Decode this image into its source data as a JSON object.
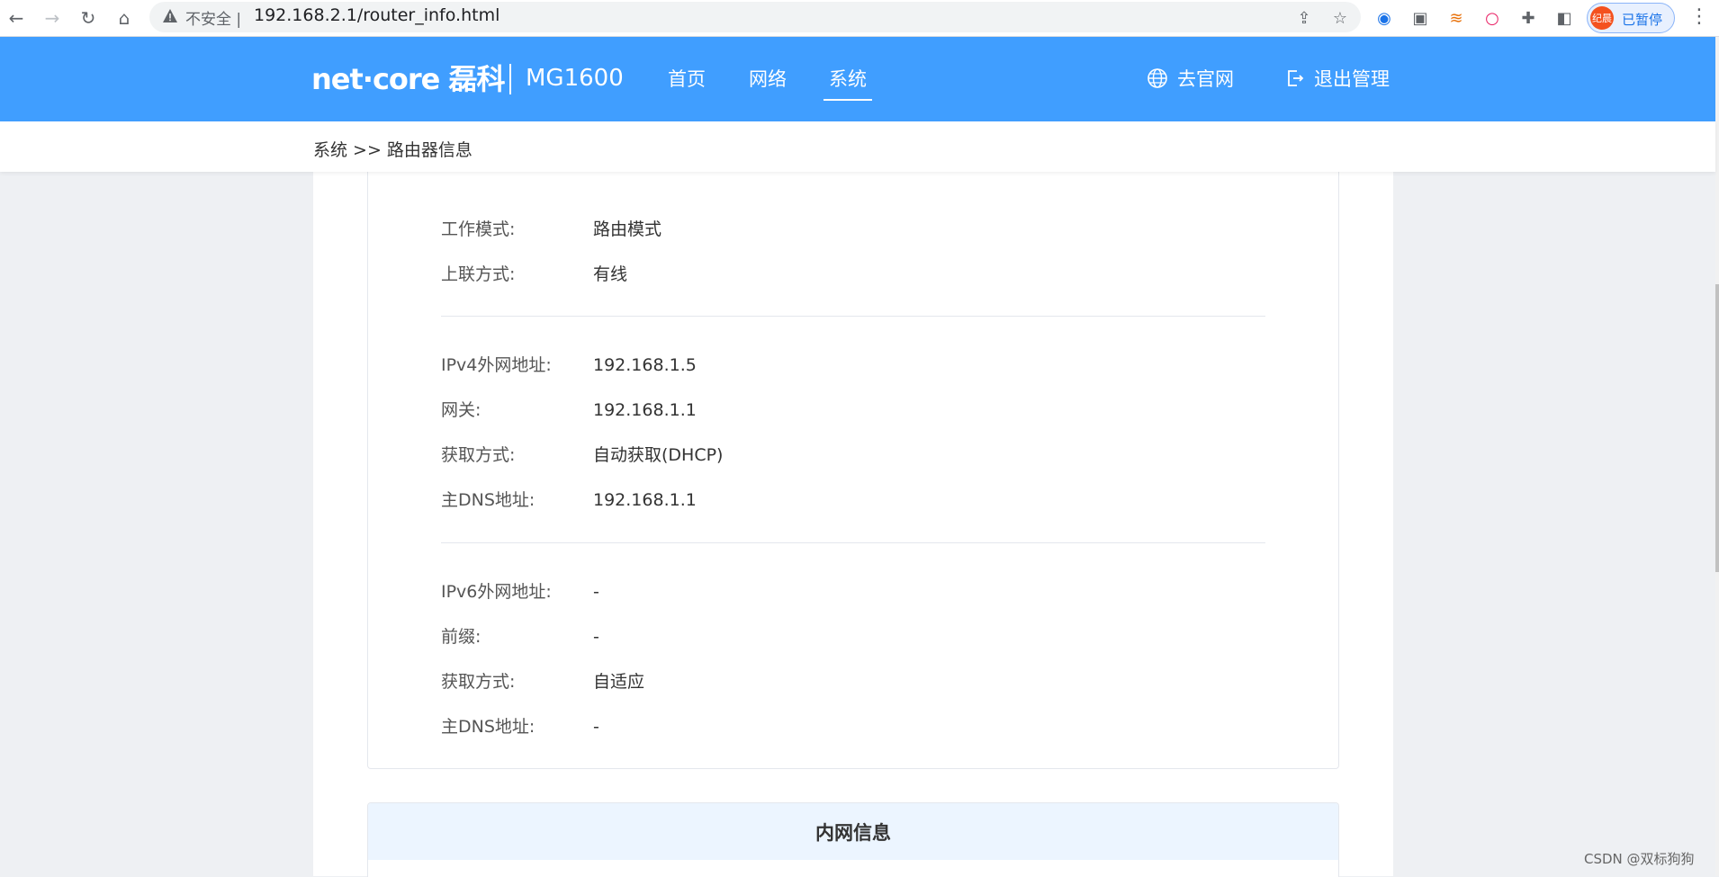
{
  "browser": {
    "url": "192.168.2.1/router_info.html",
    "security_text": "不安全",
    "profile_avatar_text": "纪晨",
    "profile_status": "已暂停"
  },
  "header": {
    "logo_main": "net·core",
    "logo_cn": "磊科",
    "model": "MG1600",
    "nav": [
      {
        "label": "首页",
        "active": false
      },
      {
        "label": "网络",
        "active": false
      },
      {
        "label": "系统",
        "active": true
      }
    ],
    "official_site": "去官网",
    "logout": "退出管理",
    "accent_color": "#409eff"
  },
  "breadcrumb": "系统 >> 路由器信息",
  "wan": {
    "basic": [
      {
        "label": "工作模式:",
        "value": "路由模式"
      },
      {
        "label": "上联方式:",
        "value": "有线"
      }
    ],
    "ipv4": [
      {
        "label": "IPv4外网地址:",
        "value": "192.168.1.5"
      },
      {
        "label": "网关:",
        "value": "192.168.1.1"
      },
      {
        "label": "获取方式:",
        "value": "自动获取(DHCP)"
      },
      {
        "label": "主DNS地址:",
        "value": "192.168.1.1"
      }
    ],
    "ipv6": [
      {
        "label": "IPv6外网地址:",
        "value": "-"
      },
      {
        "label": "前缀:",
        "value": "-"
      },
      {
        "label": "获取方式:",
        "value": "自适应"
      },
      {
        "label": "主DNS地址:",
        "value": "-"
      }
    ]
  },
  "lan_section_title": "内网信息",
  "watermark": "CSDN @双标狗狗"
}
